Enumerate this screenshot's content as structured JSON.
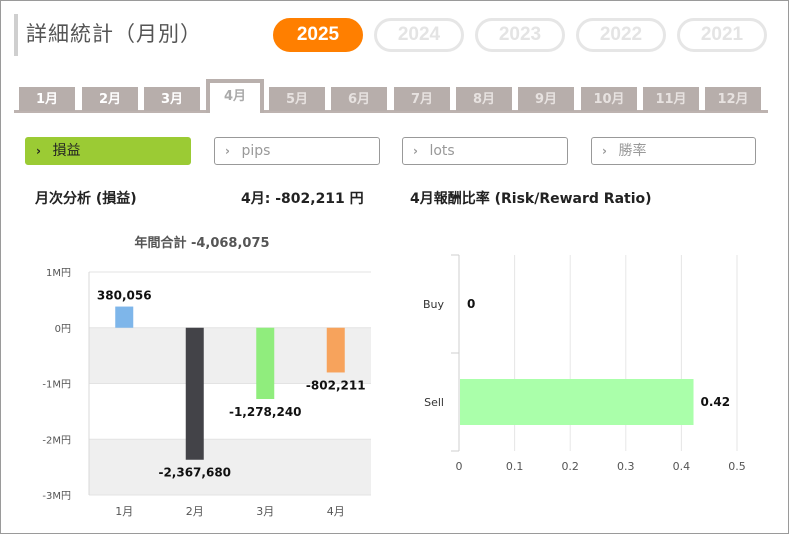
{
  "header": {
    "title": "詳細統計（月別）",
    "years": [
      {
        "label": "2025",
        "active": true
      },
      {
        "label": "2024",
        "active": false
      },
      {
        "label": "2023",
        "active": false
      },
      {
        "label": "2022",
        "active": false
      },
      {
        "label": "2021",
        "active": false
      }
    ]
  },
  "months": [
    {
      "label": "1月",
      "state": "past"
    },
    {
      "label": "2月",
      "state": "past"
    },
    {
      "label": "3月",
      "state": "past"
    },
    {
      "label": "4月",
      "state": "active"
    },
    {
      "label": "5月",
      "state": "future"
    },
    {
      "label": "6月",
      "state": "future"
    },
    {
      "label": "7月",
      "state": "future"
    },
    {
      "label": "8月",
      "state": "future"
    },
    {
      "label": "9月",
      "state": "future"
    },
    {
      "label": "10月",
      "state": "future"
    },
    {
      "label": "11月",
      "state": "future"
    },
    {
      "label": "12月",
      "state": "future"
    }
  ],
  "metrics": [
    {
      "label": "損益",
      "active": true
    },
    {
      "label": "pips",
      "active": false
    },
    {
      "label": "lots",
      "active": false
    },
    {
      "label": "勝率",
      "active": false
    }
  ],
  "left_heading": "月次分析 (損益)",
  "left_month_value": "4月:  -802,211 円",
  "right_heading": "4月報酬比率 (Risk/Reward Ratio)",
  "colors": {
    "accent_orange": "#ff7f00",
    "active_green": "#9bcb34",
    "tab_gray": "#b7aeab"
  },
  "chart_data": [
    {
      "type": "bar",
      "title": "年間合計 -4,068,075",
      "categories": [
        "1月",
        "2月",
        "3月",
        "4月"
      ],
      "values": [
        380056,
        -2367680,
        -1278240,
        -802211
      ],
      "value_labels": [
        "380,056",
        "-2,367,680",
        "-1,278,240",
        "-802,211"
      ],
      "bar_colors": [
        "#7eb6ea",
        "#434348",
        "#90ed7d",
        "#f7a35c"
      ],
      "ylim": [
        -3000000,
        1000000
      ],
      "yticks": [
        1000000,
        0,
        -1000000,
        -2000000,
        -3000000
      ],
      "ytick_labels": [
        "1M円",
        "0円",
        "-1M円",
        "-2M円",
        "-3M円"
      ],
      "grid": "alternating bands"
    },
    {
      "type": "bar",
      "orientation": "horizontal",
      "categories": [
        "Buy",
        "Sell"
      ],
      "values": [
        0,
        0.42
      ],
      "value_labels": [
        "0",
        "0.42"
      ],
      "bar_color": "#aaffaa",
      "xlim": [
        0,
        0.5
      ],
      "xticks": [
        0,
        0.1,
        0.2,
        0.3,
        0.4,
        0.5
      ],
      "xtick_labels": [
        "0",
        "0.1",
        "0.2",
        "0.3",
        "0.4",
        "0.5"
      ],
      "grid": true
    }
  ]
}
